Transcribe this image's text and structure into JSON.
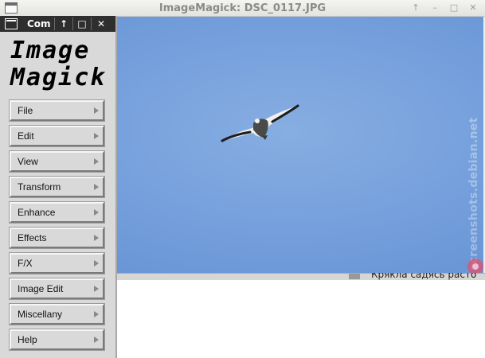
{
  "image_window": {
    "title": "ImageMagick: DSC_0117.JPG",
    "controls": {
      "up": "↑",
      "minimize": "–",
      "maximize": "□",
      "close": "✕"
    }
  },
  "commands_window": {
    "title": "Com",
    "controls": {
      "up": "↑",
      "maximize": "□",
      "close": "✕"
    },
    "logo": {
      "line1": "Image",
      "line2": "Magick"
    },
    "menu": [
      {
        "label": "File"
      },
      {
        "label": "Edit"
      },
      {
        "label": "View"
      },
      {
        "label": "Transform"
      },
      {
        "label": "Enhance"
      },
      {
        "label": "Effects"
      },
      {
        "label": "F/X"
      },
      {
        "label": "Image Edit"
      },
      {
        "label": "Miscellany"
      },
      {
        "label": "Help"
      }
    ]
  },
  "background": {
    "terminal_text": "Крякла садясь расто"
  },
  "watermark": "screenshots.debian.net",
  "colors": {
    "sky": "#739edb",
    "titlebar_dark": "#2e2e2e",
    "panel": "#d9d9d9"
  }
}
